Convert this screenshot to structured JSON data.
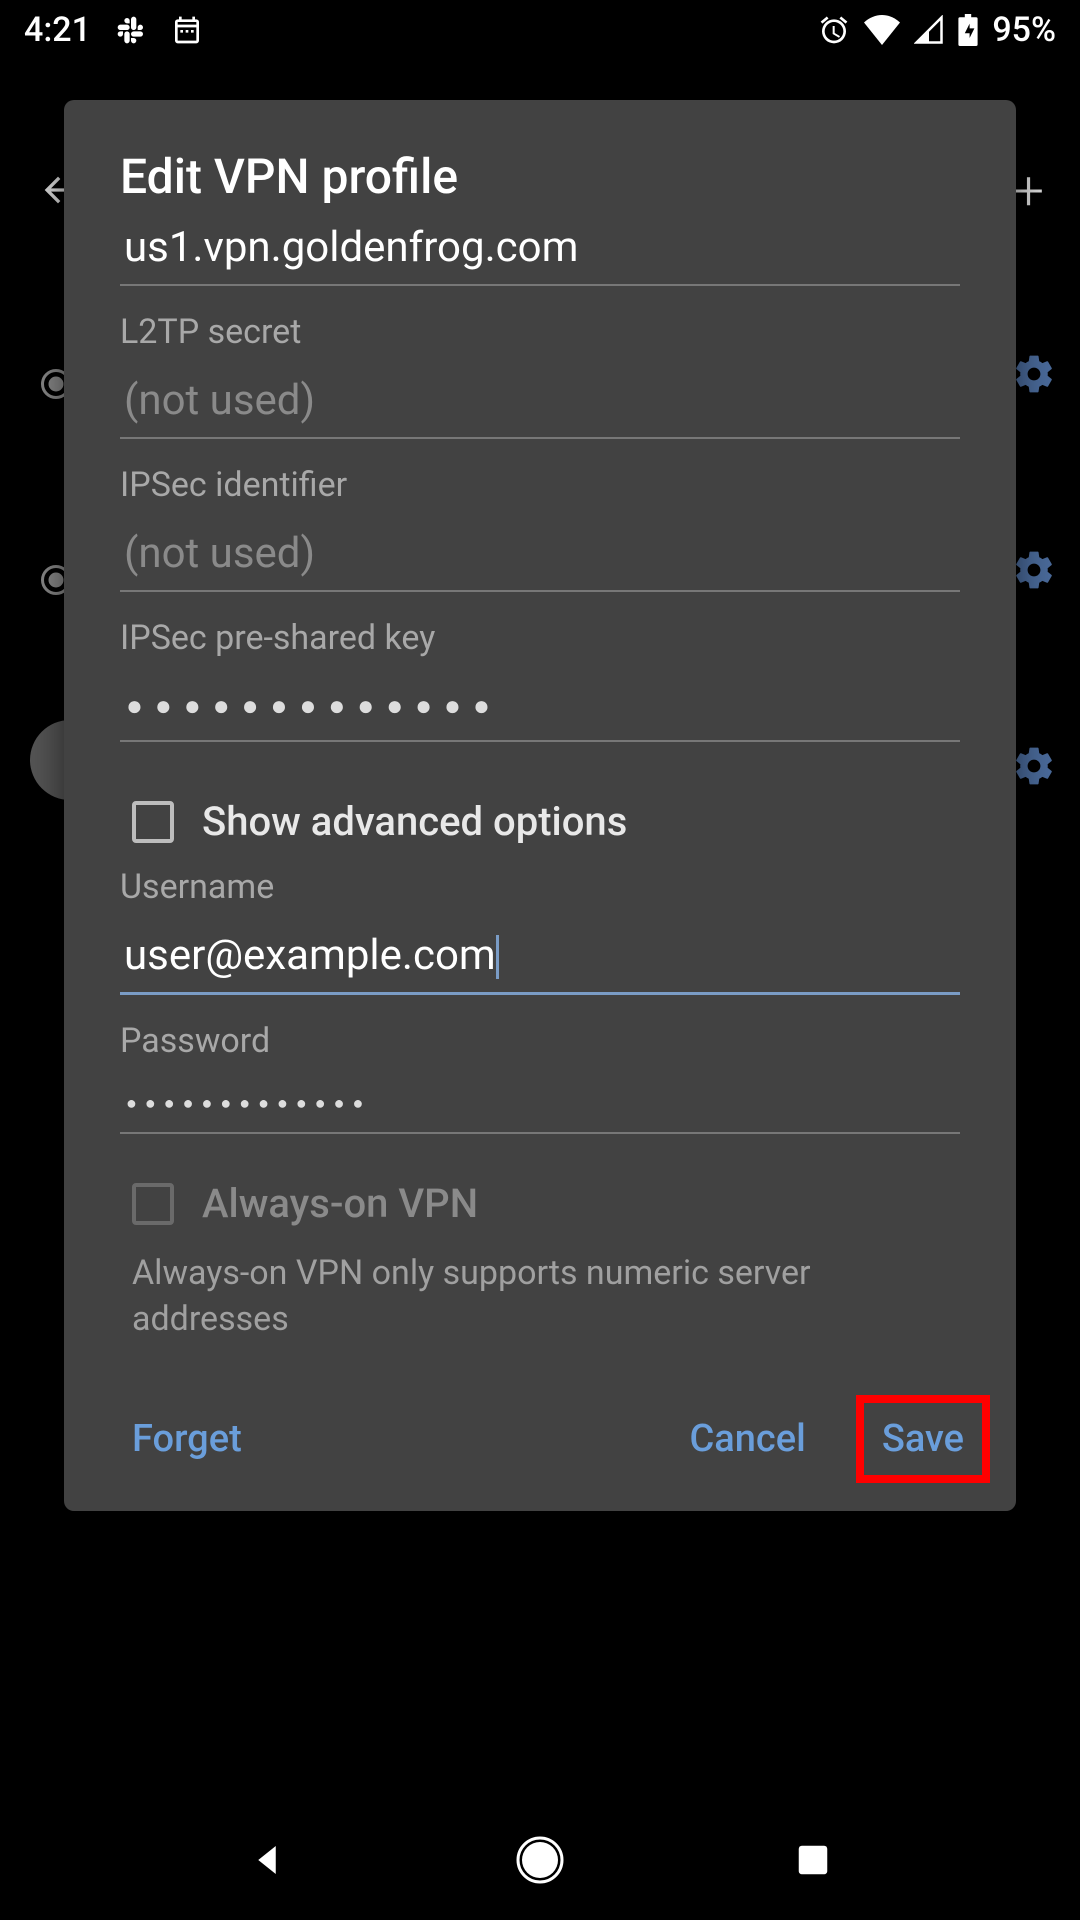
{
  "status": {
    "time": "4:21",
    "battery": "95%"
  },
  "dialog": {
    "title": "Edit VPN profile",
    "server_address": {
      "value": "us1.vpn.goldenfrog.com"
    },
    "l2tp_secret": {
      "label": "L2TP secret",
      "placeholder": "(not used)",
      "value": ""
    },
    "ipsec_identifier": {
      "label": "IPSec identifier",
      "placeholder": "(not used)",
      "value": ""
    },
    "ipsec_psk": {
      "label": "IPSec pre-shared key",
      "masked": "●●●●●●●●●●●●●"
    },
    "show_advanced": {
      "label": "Show advanced options",
      "checked": false
    },
    "username": {
      "label": "Username",
      "value": "user@example.com"
    },
    "password": {
      "label": "Password",
      "masked": "●●●●●●●●●●●●●"
    },
    "always_on": {
      "label": "Always-on VPN",
      "checked": false,
      "enabled": false
    },
    "always_on_helper": "Always-on VPN only supports numeric server addresses",
    "actions": {
      "forget": "Forget",
      "cancel": "Cancel",
      "save": "Save"
    }
  },
  "highlight": {
    "target": "save-button"
  }
}
